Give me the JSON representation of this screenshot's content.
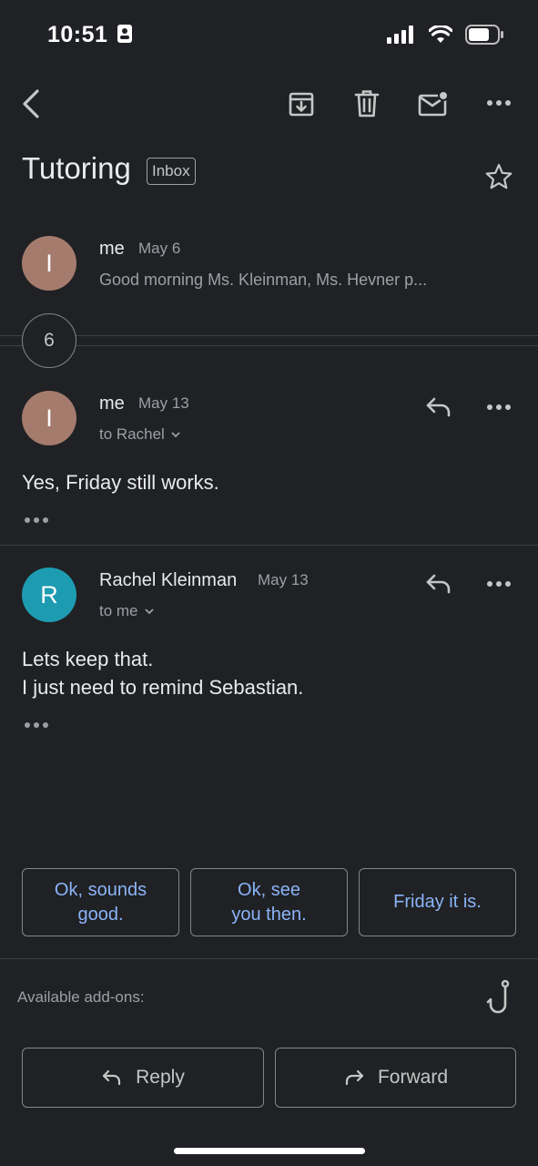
{
  "status_bar": {
    "time": "10:51"
  },
  "toolbar": {
    "back_icon": "back-arrow-icon",
    "archive_icon": "archive-icon",
    "delete_icon": "trash-icon",
    "unread_icon": "mark-unread-icon",
    "more_icon": "more-horizontal-icon"
  },
  "thread": {
    "subject": "Tutoring",
    "label": "Inbox"
  },
  "messages": [
    {
      "avatar": "I",
      "sender": "me",
      "date": "May 6",
      "snippet": "Good morning Ms. Kleinman, Ms. Hevner p..."
    },
    {
      "avatar": "I",
      "sender": "me",
      "date": "May 13",
      "to": "to Rachel",
      "body": "Yes, Friday still works."
    },
    {
      "avatar": "R",
      "sender": "Rachel Kleinman",
      "date": "May 13",
      "to": "to me",
      "body_lines": [
        "Lets keep that.",
        "I just need to remind Sebastian."
      ]
    }
  ],
  "collapsed_count": "6",
  "smart_replies": [
    {
      "line1": "Ok, sounds",
      "line2": "good."
    },
    {
      "line1": "Ok, see",
      "line2": "you then."
    },
    {
      "line1": "Friday it is.",
      "line2": ""
    }
  ],
  "addons": {
    "label": "Available add-ons:"
  },
  "actions": {
    "reply": "Reply",
    "forward": "Forward"
  },
  "colors": {
    "background": "#202124",
    "accent": "#8ab4f8",
    "avatar_me": "#a47b6c",
    "avatar_rachel": "#1d9bb1"
  }
}
